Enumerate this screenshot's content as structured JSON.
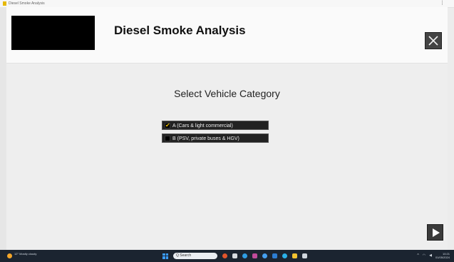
{
  "window": {
    "title_text": "Diesel Smoke Analysis",
    "menu_text": "⋮"
  },
  "header": {
    "app_title": "Diesel Smoke Analysis"
  },
  "main": {
    "prompt": "Select Vehicle Category",
    "options": [
      {
        "label": "A (Cars & light commercial)",
        "checked": true
      },
      {
        "label": "B (PSV, private buses & HGV)",
        "checked": false
      }
    ]
  },
  "icons": {
    "close": "close-icon",
    "next": "play-arrow-icon",
    "check": "checkmark-icon"
  },
  "colors": {
    "header_bg": "#fafafa",
    "body_bg": "#eeeeee",
    "option_bg": "#222222",
    "check_color": "#f2c200",
    "taskbar_bg": "#1b2430"
  },
  "taskbar": {
    "search_placeholder": "Q Search",
    "weather_text": "12° Mostly cloudy",
    "clock_time": "10:21",
    "clock_date": "01/05/2024"
  }
}
